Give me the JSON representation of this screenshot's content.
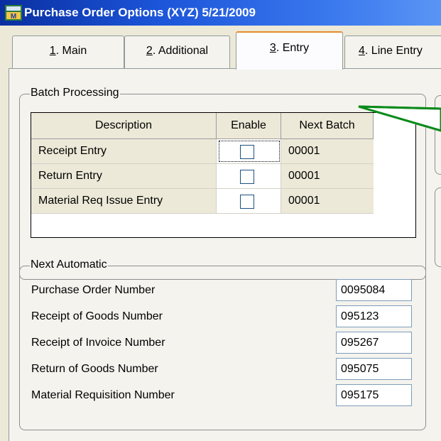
{
  "window": {
    "title": "Purchase Order Options (XYZ) 5/21/2009",
    "app_icon_letters": "M",
    "colors": {
      "titlebar": "#1b54d8",
      "panel": "#f4f3ee",
      "arrow": "#0a8a1a",
      "active_tab_accent": "#e68b2c"
    }
  },
  "tabs": [
    {
      "key": "1",
      "label": ". Main",
      "active": false
    },
    {
      "key": "2",
      "label": ". Additional",
      "active": false
    },
    {
      "key": "3",
      "label": ". Entry",
      "active": true
    },
    {
      "key": "4",
      "label": ". Line Entry",
      "active": false
    }
  ],
  "batch_processing": {
    "title": "Batch Processing",
    "columns": [
      "Description",
      "Enable",
      "Next Batch"
    ],
    "rows": [
      {
        "description": "Receipt Entry",
        "enabled": false,
        "next_batch": "00001"
      },
      {
        "description": "Return Entry",
        "enabled": false,
        "next_batch": "00001"
      },
      {
        "description": "Material Req Issue Entry",
        "enabled": false,
        "next_batch": "00001"
      }
    ]
  },
  "next_automatic": {
    "title": "Next Automatic",
    "fields": [
      {
        "label": "Purchase Order Number",
        "value": "0095084"
      },
      {
        "label": "Receipt of Goods Number",
        "value": "095123"
      },
      {
        "label": "Receipt of Invoice Number",
        "value": "095267"
      },
      {
        "label": "Return of Goods Number",
        "value": "095075"
      },
      {
        "label": "Material Requisition Number",
        "value": "095175"
      }
    ]
  }
}
